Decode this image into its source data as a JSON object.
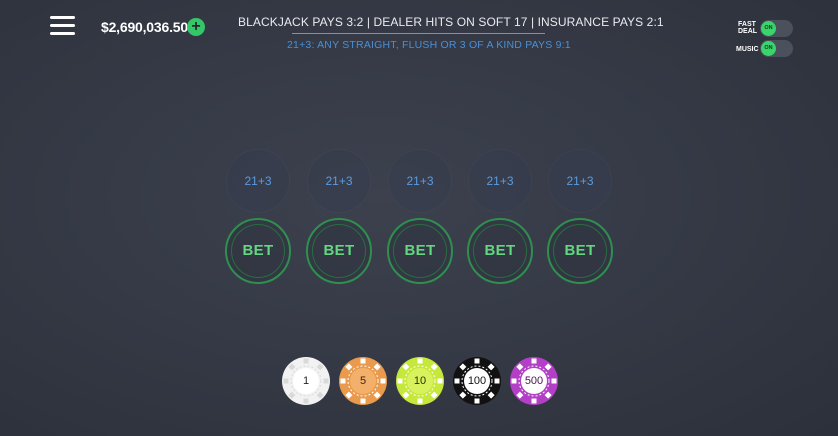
{
  "header": {
    "balance": "$2,690,036.50",
    "add_funds": "+",
    "table_rules": "BLACKJACK PAYS 3:2  |  DEALER HITS ON SOFT 17  |  INSURANCE PAYS 2:1",
    "sidebet_rule": "21+3: ANY STRAIGHT, FLUSH OR 3 OF A KIND PAYS 9:1"
  },
  "toggles": {
    "fast_deal": {
      "label_line1": "FAST",
      "label_line2": "DEAL",
      "state": "ON"
    },
    "music": {
      "label": "MUSIC",
      "state": "ON"
    }
  },
  "seats": [
    {
      "sidebet": "21+3",
      "bet": "BET"
    },
    {
      "sidebet": "21+3",
      "bet": "BET"
    },
    {
      "sidebet": "21+3",
      "bet": "BET"
    },
    {
      "sidebet": "21+3",
      "bet": "BET"
    },
    {
      "sidebet": "21+3",
      "bet": "BET"
    }
  ],
  "chips": [
    {
      "value": "1",
      "color": "#f2f2f2",
      "face_color": "#ffffff",
      "text_color": "#222222",
      "stripe": "#d9d9d9"
    },
    {
      "value": "5",
      "color": "#e99a4c",
      "face_color": "#f3b06a",
      "text_color": "#3a2410",
      "stripe": "#ffffff"
    },
    {
      "value": "10",
      "color": "#c6e83a",
      "face_color": "#d7f25c",
      "text_color": "#26300a",
      "stripe": "#ffffff"
    },
    {
      "value": "100",
      "color": "#111111",
      "face_color": "#ffffff",
      "text_color": "#111111",
      "stripe": "#ffffff"
    },
    {
      "value": "500",
      "color": "#b43fc7",
      "face_color": "#ffffff",
      "text_color": "#4a1552",
      "stripe": "#ffffff"
    }
  ],
  "colors": {
    "accent_green": "#34c76a",
    "sidebet_text": "#5b9be0",
    "rule_text_blue": "#4a8fd6"
  }
}
